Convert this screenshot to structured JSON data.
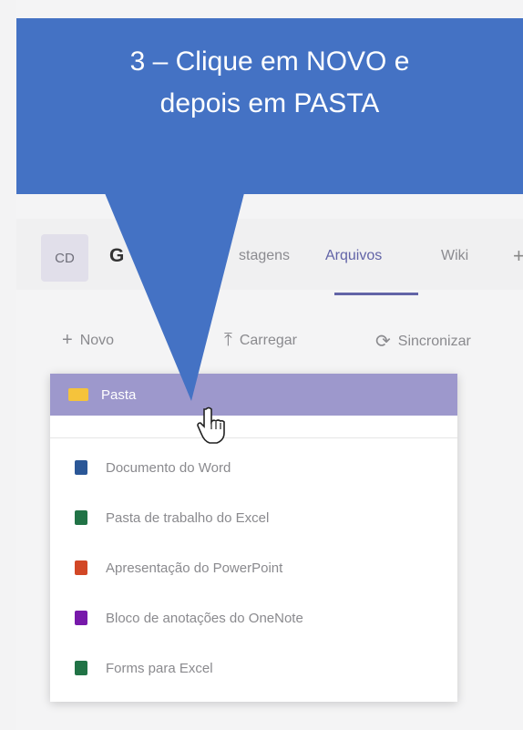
{
  "callout": {
    "line1": "3 – Clique em NOVO e",
    "line2": "depois em PASTA",
    "color": "#4472c4"
  },
  "header": {
    "avatar_initials": "CD",
    "team_name": "G",
    "tabs": [
      {
        "label": "stagens"
      },
      {
        "label": "Arquivos"
      },
      {
        "label": "Wiki"
      }
    ],
    "add_tab": "+"
  },
  "toolbar": {
    "new_label": "Novo",
    "upload_label": "Carregar",
    "sync_label": "Sincronizar"
  },
  "menu": {
    "items": [
      {
        "label": "Pasta",
        "icon": "folder-icon",
        "color": "#f5c33b"
      },
      {
        "label": "Documento do Word",
        "icon": "word-icon",
        "color": "#2b5797"
      },
      {
        "label": "Pasta de trabalho do Excel",
        "icon": "excel-icon",
        "color": "#217346"
      },
      {
        "label": "Apresentação do PowerPoint",
        "icon": "powerpoint-icon",
        "color": "#d24726"
      },
      {
        "label": "Bloco de anotações do OneNote",
        "icon": "onenote-icon",
        "color": "#7719aa"
      },
      {
        "label": "Forms para Excel",
        "icon": "forms-excel-icon",
        "color": "#217346"
      }
    ],
    "selected_color": "#9d98cc"
  },
  "accent_color": "#6264a7"
}
